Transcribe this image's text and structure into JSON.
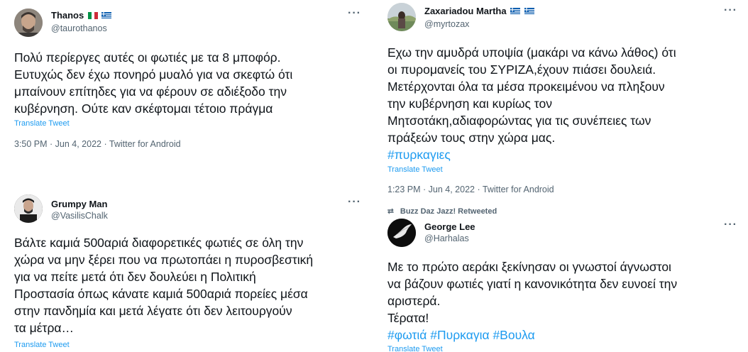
{
  "tweets": [
    {
      "name": "Thanos",
      "handle": "@taurothanos",
      "text": "Πολύ περίεργες αυτές οι φωτιές με τα 8 μποφόρ.\nΕυτυχώς δεν έχω πονηρό μυαλό για να σκεφτώ ότι\nμπαίνουν επίτηδες για να φέρουν σε αδιέξοδο την\nκυβέρνηση. Ούτε καν σκέφτομαι τέτοιο πράγμα",
      "translate": "Translate Tweet",
      "meta": "3:50 PM · Jun 4, 2022 · Twitter for Android",
      "flags": [
        "italy-flag",
        "greece-flag"
      ]
    },
    {
      "name": "Zaxariadou Martha",
      "handle": "@myrtozax",
      "text": "Εχω την αμυδρά υποψία (μακάρι να κάνω λάθος) ότι\nοι πυρομανείς του ΣΥΡΙΖΑ,έχουν πιάσει δουλειά.\nΜετέρχονται όλα τα μέσα προκειμένου να πληξουν\nτην κυβέρνηση και κυρίως τον\nΜητσοτάκη,αδιαφορώντας για τις συνέπειες των\nπράξεών τους στην χώρα μας.",
      "hashtags": "#πυρκαγιες",
      "translate": "Translate Tweet",
      "meta": "1:23 PM · Jun 4, 2022 · Twitter for Android",
      "flags": [
        "greece-flag",
        "greece-flag"
      ]
    },
    {
      "name": "Grumpy Man",
      "handle": "@VasilisChalk",
      "text": "Βάλτε καμιά 500αριά διαφορετικές φωτιές σε όλη την\nχώρα να μην ξέρει που να πρωτοπάει η πυροσβεστική\nγια να πείτε μετά ότι δεν δουλεύει η Πολιτική\nΠροστασία όπως κάνατε καμιά 500αριά πορείες μέσα\nστην πανδημία και μετά λέγατε ότι δεν λειτουργούν\nτα μέτρα…",
      "translate": "Translate Tweet"
    },
    {
      "retweeted_by": "Buzz Daz Jazz! Retweeted",
      "name": "George Lee",
      "handle": "@Harhalas",
      "text": "Με το πρώτο αεράκι ξεκίνησαν οι γνωστοί άγνωστοι\nνα βάζουν φωτιές γιατί η κανονικότητα δεν ευνοεί την\nαριστερά.\nΤέρατα!",
      "hashtags": "#φωτιά #Πυρκαγια #Βουλα",
      "translate": "Translate Tweet"
    }
  ],
  "more_glyph": "···",
  "retweet_glyph": "⮂",
  "colors": {
    "link": "#1d9bf0",
    "secondary": "#536471",
    "text": "#0f1419"
  }
}
